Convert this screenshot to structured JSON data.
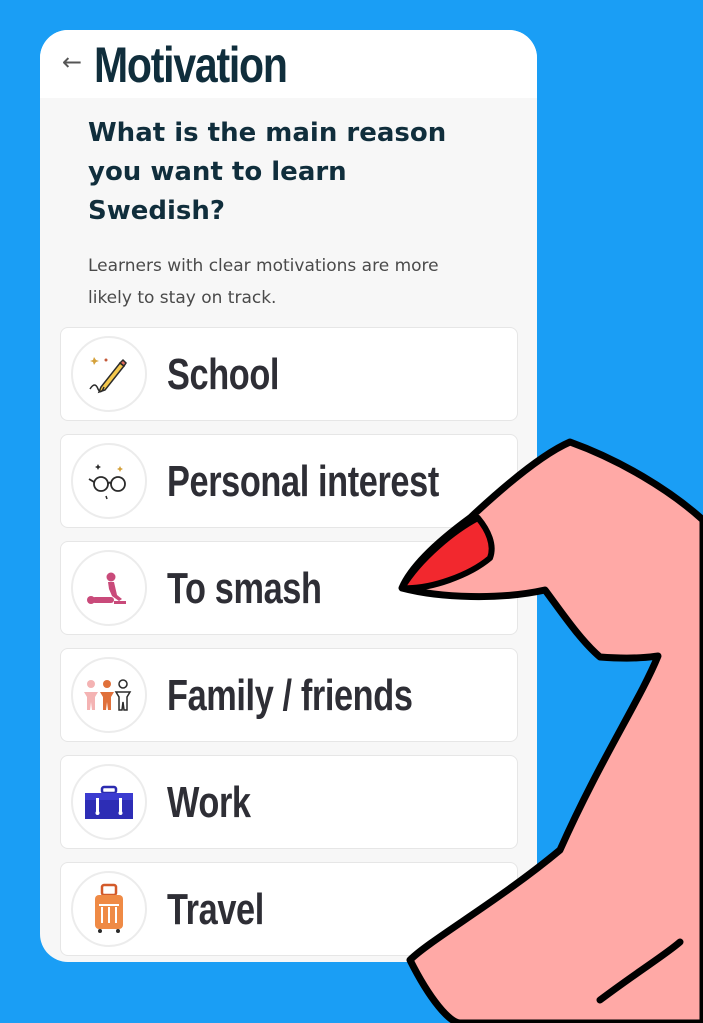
{
  "header": {
    "back_icon": "arrow-left-icon",
    "title": "Motivation"
  },
  "question": "What is the main reason you want to learn Swedish?",
  "subtitle": "Learners with clear motivations are more likely to stay on track.",
  "options": [
    {
      "label": "School",
      "icon": "pencil-icon"
    },
    {
      "label": "Personal interest",
      "icon": "glasses-icon"
    },
    {
      "label": "To smash",
      "icon": "couple-icon"
    },
    {
      "label": "Family / friends",
      "icon": "people-icon"
    },
    {
      "label": "Work",
      "icon": "briefcase-icon"
    },
    {
      "label": "Travel",
      "icon": "suitcase-icon"
    }
  ],
  "colors": {
    "background": "#1a9ef5",
    "title": "#102e3c",
    "finger": "#ffa9a6",
    "nail": "#f2282e"
  }
}
